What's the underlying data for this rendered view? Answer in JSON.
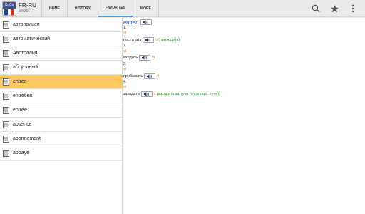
{
  "app": {
    "brand_text": "CoCo",
    "title": "FR-RU",
    "subtitle": "entrer",
    "flag_colors": [
      "#1d3f96",
      "#ffffff",
      "#d52b1e"
    ]
  },
  "tabs": [
    {
      "label": "HOME",
      "active": false
    },
    {
      "label": "HISTORY",
      "active": false
    },
    {
      "label": "FAVORITES",
      "active": true
    },
    {
      "label": "MORE",
      "active": false
    }
  ],
  "actions": [
    "search-icon",
    "star-icon",
    "overflow-menu-icon"
  ],
  "words": [
    {
      "label": "автоприцеп",
      "selected": false
    },
    {
      "label": "автоматический",
      "selected": false
    },
    {
      "label": "Австралия",
      "selected": false
    },
    {
      "label": "абсурдный",
      "selected": false
    },
    {
      "label": "entrer",
      "selected": true
    },
    {
      "label": "entretien",
      "selected": false
    },
    {
      "label": "entrée",
      "selected": false
    },
    {
      "label": "absence",
      "selected": false
    },
    {
      "label": "abonnement",
      "selected": false
    },
    {
      "label": "abbaye",
      "selected": false
    }
  ],
  "entry": {
    "headword": "entrer",
    "senses": [
      {
        "num": "1.",
        "pos": "vi",
        "translation": "поступать",
        "verb_tag": "v",
        "note": "(приходить)"
      },
      {
        "num": "2.",
        "pos": "vi",
        "translation": "входить",
        "verb_tag": "vi",
        "note": ""
      },
      {
        "num": "3.",
        "pos": "vi",
        "translation": "прибывать",
        "verb_tag": "v",
        "note": ""
      },
      {
        "num": "4.",
        "pos": "vi",
        "translation": "заходить",
        "verb_tag": "v",
        "note": "(заходить за тучи (о солнце, луне))"
      }
    ]
  },
  "colors": {
    "accent_selected": "#fbc95f",
    "headword": "#1a3e8c",
    "pos": "#e07c12",
    "note": "#2f8f2f",
    "tab_underline": "#4f9ad6"
  }
}
